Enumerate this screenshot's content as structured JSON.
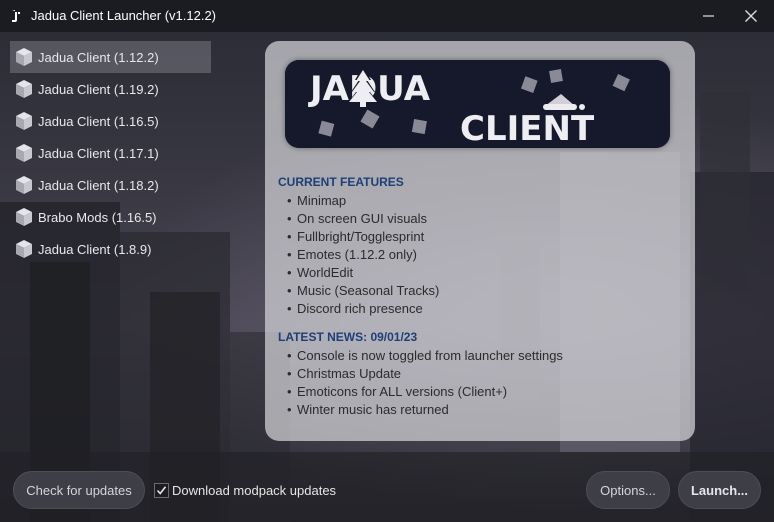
{
  "window": {
    "title": "Jadua Client Launcher (v1.12.2)",
    "icon": "jadua-logo-icon",
    "minimize_icon": "minimize-icon",
    "close_icon": "close-icon"
  },
  "sidebar": {
    "items": [
      {
        "label": "Jadua Client (1.12.2)",
        "icon": "cube-icon",
        "selected": true
      },
      {
        "label": "Jadua Client (1.19.2)",
        "icon": "cube-icon",
        "selected": false
      },
      {
        "label": "Jadua Client (1.16.5)",
        "icon": "cube-icon",
        "selected": false
      },
      {
        "label": "Jadua Client (1.17.1)",
        "icon": "cube-icon",
        "selected": false
      },
      {
        "label": "Jadua Client (1.18.2)",
        "icon": "cube-icon",
        "selected": false
      },
      {
        "label": "Brabo Mods (1.16.5)",
        "icon": "cube-icon",
        "selected": false
      },
      {
        "label": "Jadua Client (1.8.9)",
        "icon": "cube-icon",
        "selected": false
      }
    ]
  },
  "info": {
    "logo": {
      "line1": "JADUA",
      "line2": "CLIENT"
    },
    "features_heading": "CURRENT FEATURES",
    "features": [
      "Minimap",
      "On screen GUI visuals",
      "Fullbright/Togglesprint",
      "Emotes (1.12.2 only)",
      "WorldEdit",
      "Music (Seasonal Tracks)",
      "Discord rich presence"
    ],
    "news_heading": "LATEST NEWS: 09/01/23",
    "news": [
      "Console is now toggled from launcher settings",
      "Christmas Update",
      "Emoticons for ALL versions (Client+)",
      "Winter music has returned"
    ]
  },
  "footer": {
    "check_updates_label": "Check for updates",
    "download_updates_label": "Download modpack updates",
    "download_updates_checked": true,
    "options_label": "Options...",
    "launch_label": "Launch..."
  },
  "colors": {
    "window_bg": "#1b1c21",
    "heading_blue": "#1e3f78",
    "logo_bg": "#16182c"
  }
}
